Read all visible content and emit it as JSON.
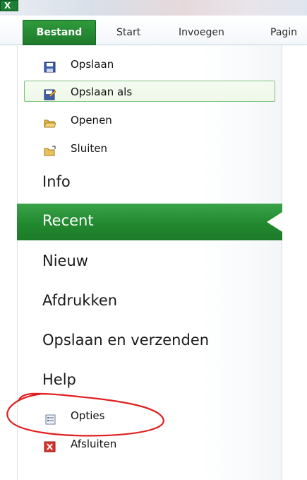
{
  "app": {
    "icon": "excel-icon"
  },
  "ribbon": {
    "tabs": [
      {
        "label": "Bestand"
      },
      {
        "label": "Start"
      },
      {
        "label": "Invoegen"
      },
      {
        "label": "Pagin"
      }
    ]
  },
  "backstage": {
    "commands": [
      {
        "label": "Opslaan",
        "icon": "save-icon"
      },
      {
        "label": "Opslaan als",
        "icon": "save-as-icon"
      },
      {
        "label": "Openen",
        "icon": "open-folder-icon"
      },
      {
        "label": "Sluiten",
        "icon": "close-folder-icon"
      }
    ],
    "sections": [
      {
        "label": "Info"
      },
      {
        "label": "Recent"
      },
      {
        "label": "Nieuw"
      },
      {
        "label": "Afdrukken"
      },
      {
        "label": "Opslaan en verzenden"
      },
      {
        "label": "Help"
      }
    ],
    "footer": [
      {
        "label": "Opties",
        "icon": "options-icon"
      },
      {
        "label": "Afsluiten",
        "icon": "exit-icon"
      }
    ]
  },
  "colors": {
    "accent": "#22892f",
    "annotation": "#e02020"
  }
}
